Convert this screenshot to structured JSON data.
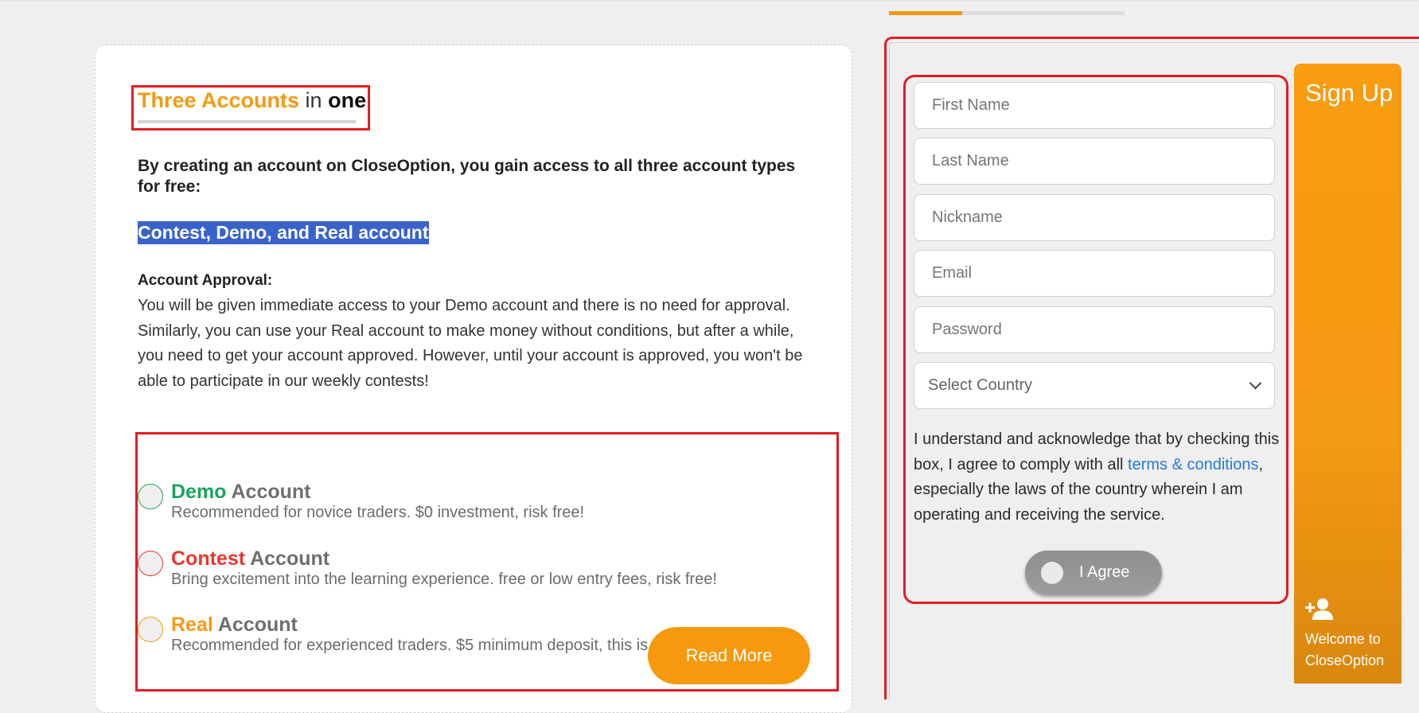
{
  "progress": {
    "fraction": 0.31
  },
  "info_card": {
    "title": {
      "part1": "Three Accounts",
      "part2": " in ",
      "part3": "one"
    },
    "intro": "By creating an account on CloseOption, you gain access to all three account types for free:",
    "highlight": "Contest, Demo, and Real account",
    "approval_heading": "Account Approval:",
    "approval_text": "You will be given immediate access to your Demo account and there is no need for approval. Similarly, you can use your Real account to make money without conditions, but after a while, you need to get your account approved. However, until your account is approved, you won't be able to participate in our weekly contests!",
    "accounts": [
      {
        "name": "Demo",
        "suffix": " Account",
        "color": "#1aa35c",
        "description": "Recommended for novice traders. $0 investment, risk free!"
      },
      {
        "name": "Contest",
        "suffix": " Account",
        "color": "#e8372e",
        "description": "Bring excitement into the learning experience. free or low entry fees, risk free!"
      },
      {
        "name": "Real",
        "suffix": " Account",
        "color": "#f39a12",
        "description": "Recommended for experienced traders. $5 minimum deposit, this is somehow risky!"
      }
    ],
    "read_more_label": "Read More"
  },
  "signup_form": {
    "first_name_placeholder": "First Name",
    "last_name_placeholder": "Last Name",
    "nickname_placeholder": "Nickname",
    "email_placeholder": "Email",
    "password_placeholder": "Password",
    "country_selected": "Select Country",
    "terms_before": "I understand and acknowledge that by checking this box, I agree to comply with all ",
    "terms_link": "terms & conditions",
    "terms_after": ", especially the laws of the country wherein I am operating and receiving the service.",
    "agree_label": "I Agree"
  },
  "side_panel": {
    "title": "Sign Up",
    "icon": "user-plus-icon",
    "welcome": "Welcome to CloseOption"
  },
  "colors": {
    "accent": "#f39a12",
    "annotation_red": "#e31c23",
    "highlight_blue": "#3a63c9",
    "link_blue": "#2579e0"
  }
}
